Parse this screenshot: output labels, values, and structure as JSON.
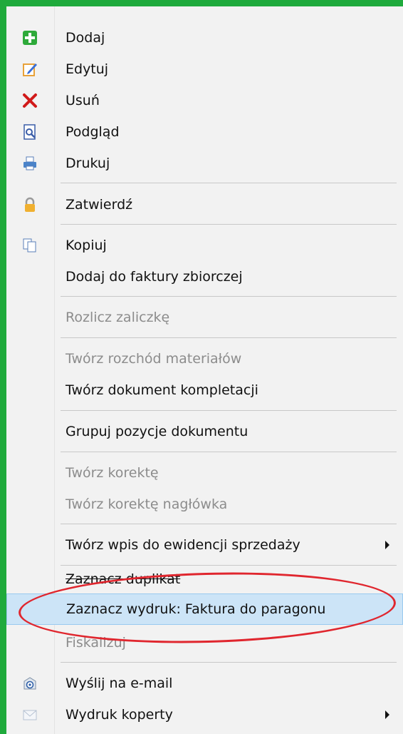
{
  "menu": {
    "items": [
      {
        "label": "Dodaj",
        "icon": "plus-icon"
      },
      {
        "label": "Edytuj",
        "icon": "edit-icon"
      },
      {
        "label": "Usuń",
        "icon": "delete-x-icon"
      },
      {
        "label": "Podgląd",
        "icon": "preview-icon"
      },
      {
        "label": "Drukuj",
        "icon": "printer-icon"
      },
      {
        "label": "Zatwierdź",
        "icon": "lock-icon"
      },
      {
        "label": "Kopiuj",
        "icon": "copy-icon"
      },
      {
        "label": "Dodaj do faktury zbiorczej"
      },
      {
        "label": "Rozlicz zaliczkę",
        "disabled": true
      },
      {
        "label": "Twórz rozchód materiałów",
        "disabled": true
      },
      {
        "label": "Twórz dokument kompletacji"
      },
      {
        "label": "Grupuj pozycje dokumentu"
      },
      {
        "label": "Twórz korektę",
        "disabled": true
      },
      {
        "label": "Twórz korektę nagłówka",
        "disabled": true
      },
      {
        "label": "Twórz wpis do ewidencji sprzedaży",
        "submenu": true
      },
      {
        "label": "Zaznacz duplikat"
      },
      {
        "label": "Zaznacz wydruk: Faktura do paragonu",
        "highlighted": true
      },
      {
        "label": "Fiskalizuj",
        "disabled": true
      },
      {
        "label": "Wyślij na e-mail",
        "icon": "email-icon"
      },
      {
        "label": "Wydruk koperty",
        "icon": "envelope-icon",
        "submenu": true
      }
    ]
  },
  "colors": {
    "frame": "#1faa3c",
    "highlight": "#cce4f7",
    "annotation": "#e0262e",
    "disabled_text": "#8c8c8c"
  }
}
